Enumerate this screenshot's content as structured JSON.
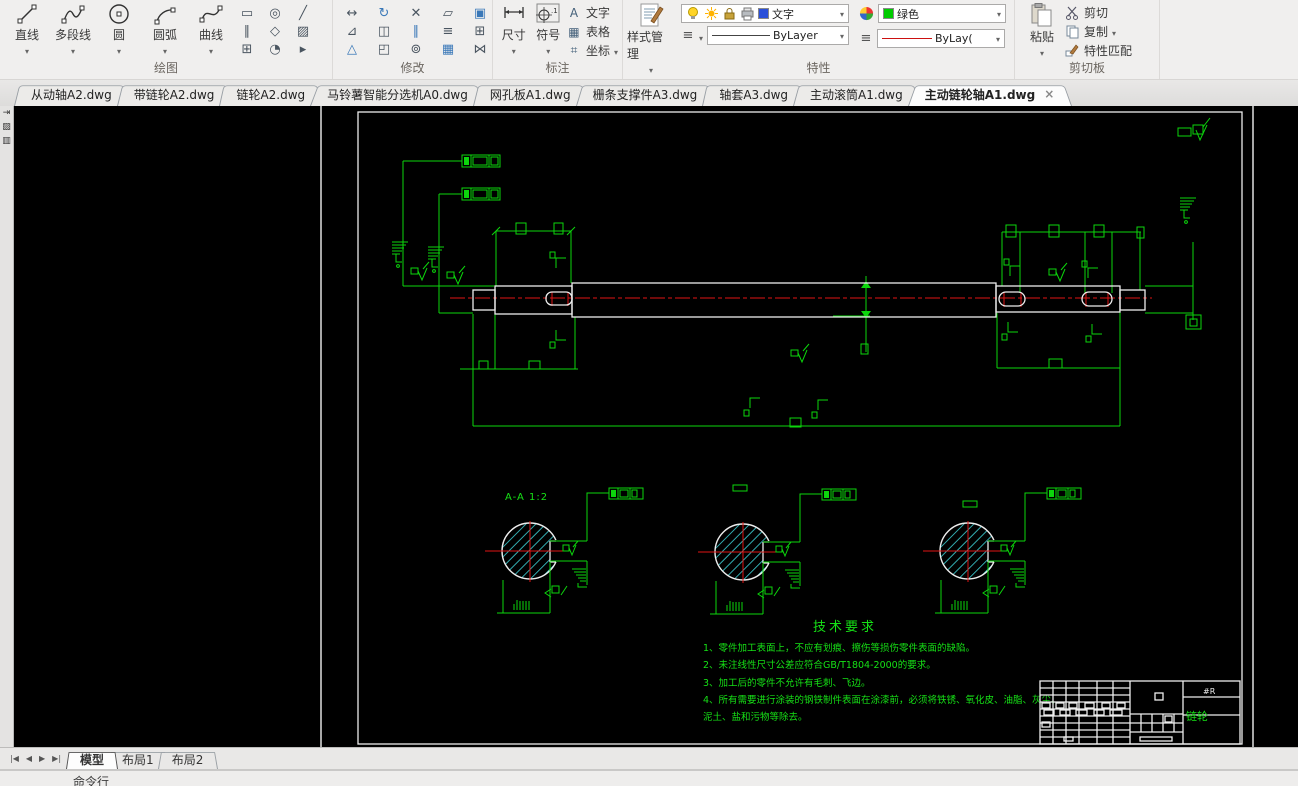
{
  "ribbon": {
    "draw": {
      "label": "绘图",
      "tools": [
        {
          "name": "line",
          "label": "直线"
        },
        {
          "name": "polyline",
          "label": "多段线"
        },
        {
          "name": "circle",
          "label": "圆"
        },
        {
          "name": "arc",
          "label": "圆弧"
        },
        {
          "name": "spline",
          "label": "曲线"
        }
      ],
      "mini": [
        "▭",
        "◎",
        "╱",
        "∥",
        "◇",
        "▨",
        "⊞",
        "◔",
        "▸"
      ]
    },
    "modify": {
      "label": "修改",
      "icons": [
        "↔",
        "↻",
        "✕",
        "▱",
        "▣",
        "⊿",
        "◫",
        "∥",
        "≡",
        "⊞",
        "△",
        "◰",
        "⊚",
        "▦",
        "⋈"
      ]
    },
    "annotate": {
      "label": "标注",
      "dim": "尺寸",
      "symbol": "符号",
      "symbol_sup": ".1",
      "text": "文字",
      "text_icon": "A",
      "table": "表格",
      "table_icon": "▦",
      "coord": "坐标",
      "coord_icon": "⌗"
    },
    "props": {
      "label": "特性",
      "style_mgr": "样式管理",
      "layer_name": "文字",
      "linetype": "ByLayer",
      "color_name": "绿色",
      "lineweight": "ByLay("
    },
    "clipboard": {
      "label": "剪切板",
      "paste": "粘贴",
      "cut": "剪切",
      "copy": "复制",
      "match": "特性匹配"
    }
  },
  "doc_tabs": [
    {
      "label": "从动轴A2.dwg"
    },
    {
      "label": "带链轮A2.dwg"
    },
    {
      "label": "链轮A2.dwg"
    },
    {
      "label": "马铃薯智能分选机A0.dwg"
    },
    {
      "label": "网孔板A1.dwg"
    },
    {
      "label": "栅条支撑件A3.dwg"
    },
    {
      "label": "轴套A3.dwg"
    },
    {
      "label": "主动滚筒A1.dwg"
    },
    {
      "label": "主动链轮轴A1.dwg",
      "active": true
    }
  ],
  "side_icons": [
    {
      "name": "annotation-tool-icon",
      "glyph": "⇥"
    },
    {
      "name": "hatch-tool-icon",
      "glyph": "▨"
    },
    {
      "name": "table-tool-icon",
      "glyph": "▥"
    }
  ],
  "drawing": {
    "section_label": "A-A 1:2",
    "tech": {
      "title": "技术要求",
      "items": [
        "1、零件加工表面上，不应有划痕、擦伤等损伤零件表面的缺陷。",
        "2、未注线性尺寸公差应符合GB/T1804-2000的要求。",
        "3、加工后的零件不允许有毛刺、飞边。",
        "4、所有需要进行涂装的钢铁制件表面在涂漆前，必须将铁锈、氧化皮、油脂、灰尘、"
      ],
      "item4b": "泥土、盐和污物等除去。"
    },
    "title_block": {
      "part_name": "链轮",
      "code": "#R"
    }
  },
  "statusbar": {
    "nav": [
      {
        "name": "first-tab-button",
        "glyph": "|◀"
      },
      {
        "name": "prev-tab-button",
        "glyph": "◀"
      },
      {
        "name": "next-tab-button",
        "glyph": "▶"
      },
      {
        "name": "last-tab-button",
        "glyph": "▶|"
      }
    ],
    "tabs": [
      {
        "label": "模型",
        "active": true
      },
      {
        "label": "布局1"
      },
      {
        "label": "布局2"
      }
    ]
  },
  "command": {
    "label": "命令行"
  },
  "colors": {
    "canvas_bg": "#000000",
    "drawing_green": "#0cd60c",
    "centerline_red": "#e01414",
    "hatch_cyan": "#3fd6db",
    "outline_white": "#ededed",
    "layer_swatch_blue": "#2b50d9",
    "color_swatch_green": "#00cc00",
    "lineweight_red": "#cc1111"
  }
}
